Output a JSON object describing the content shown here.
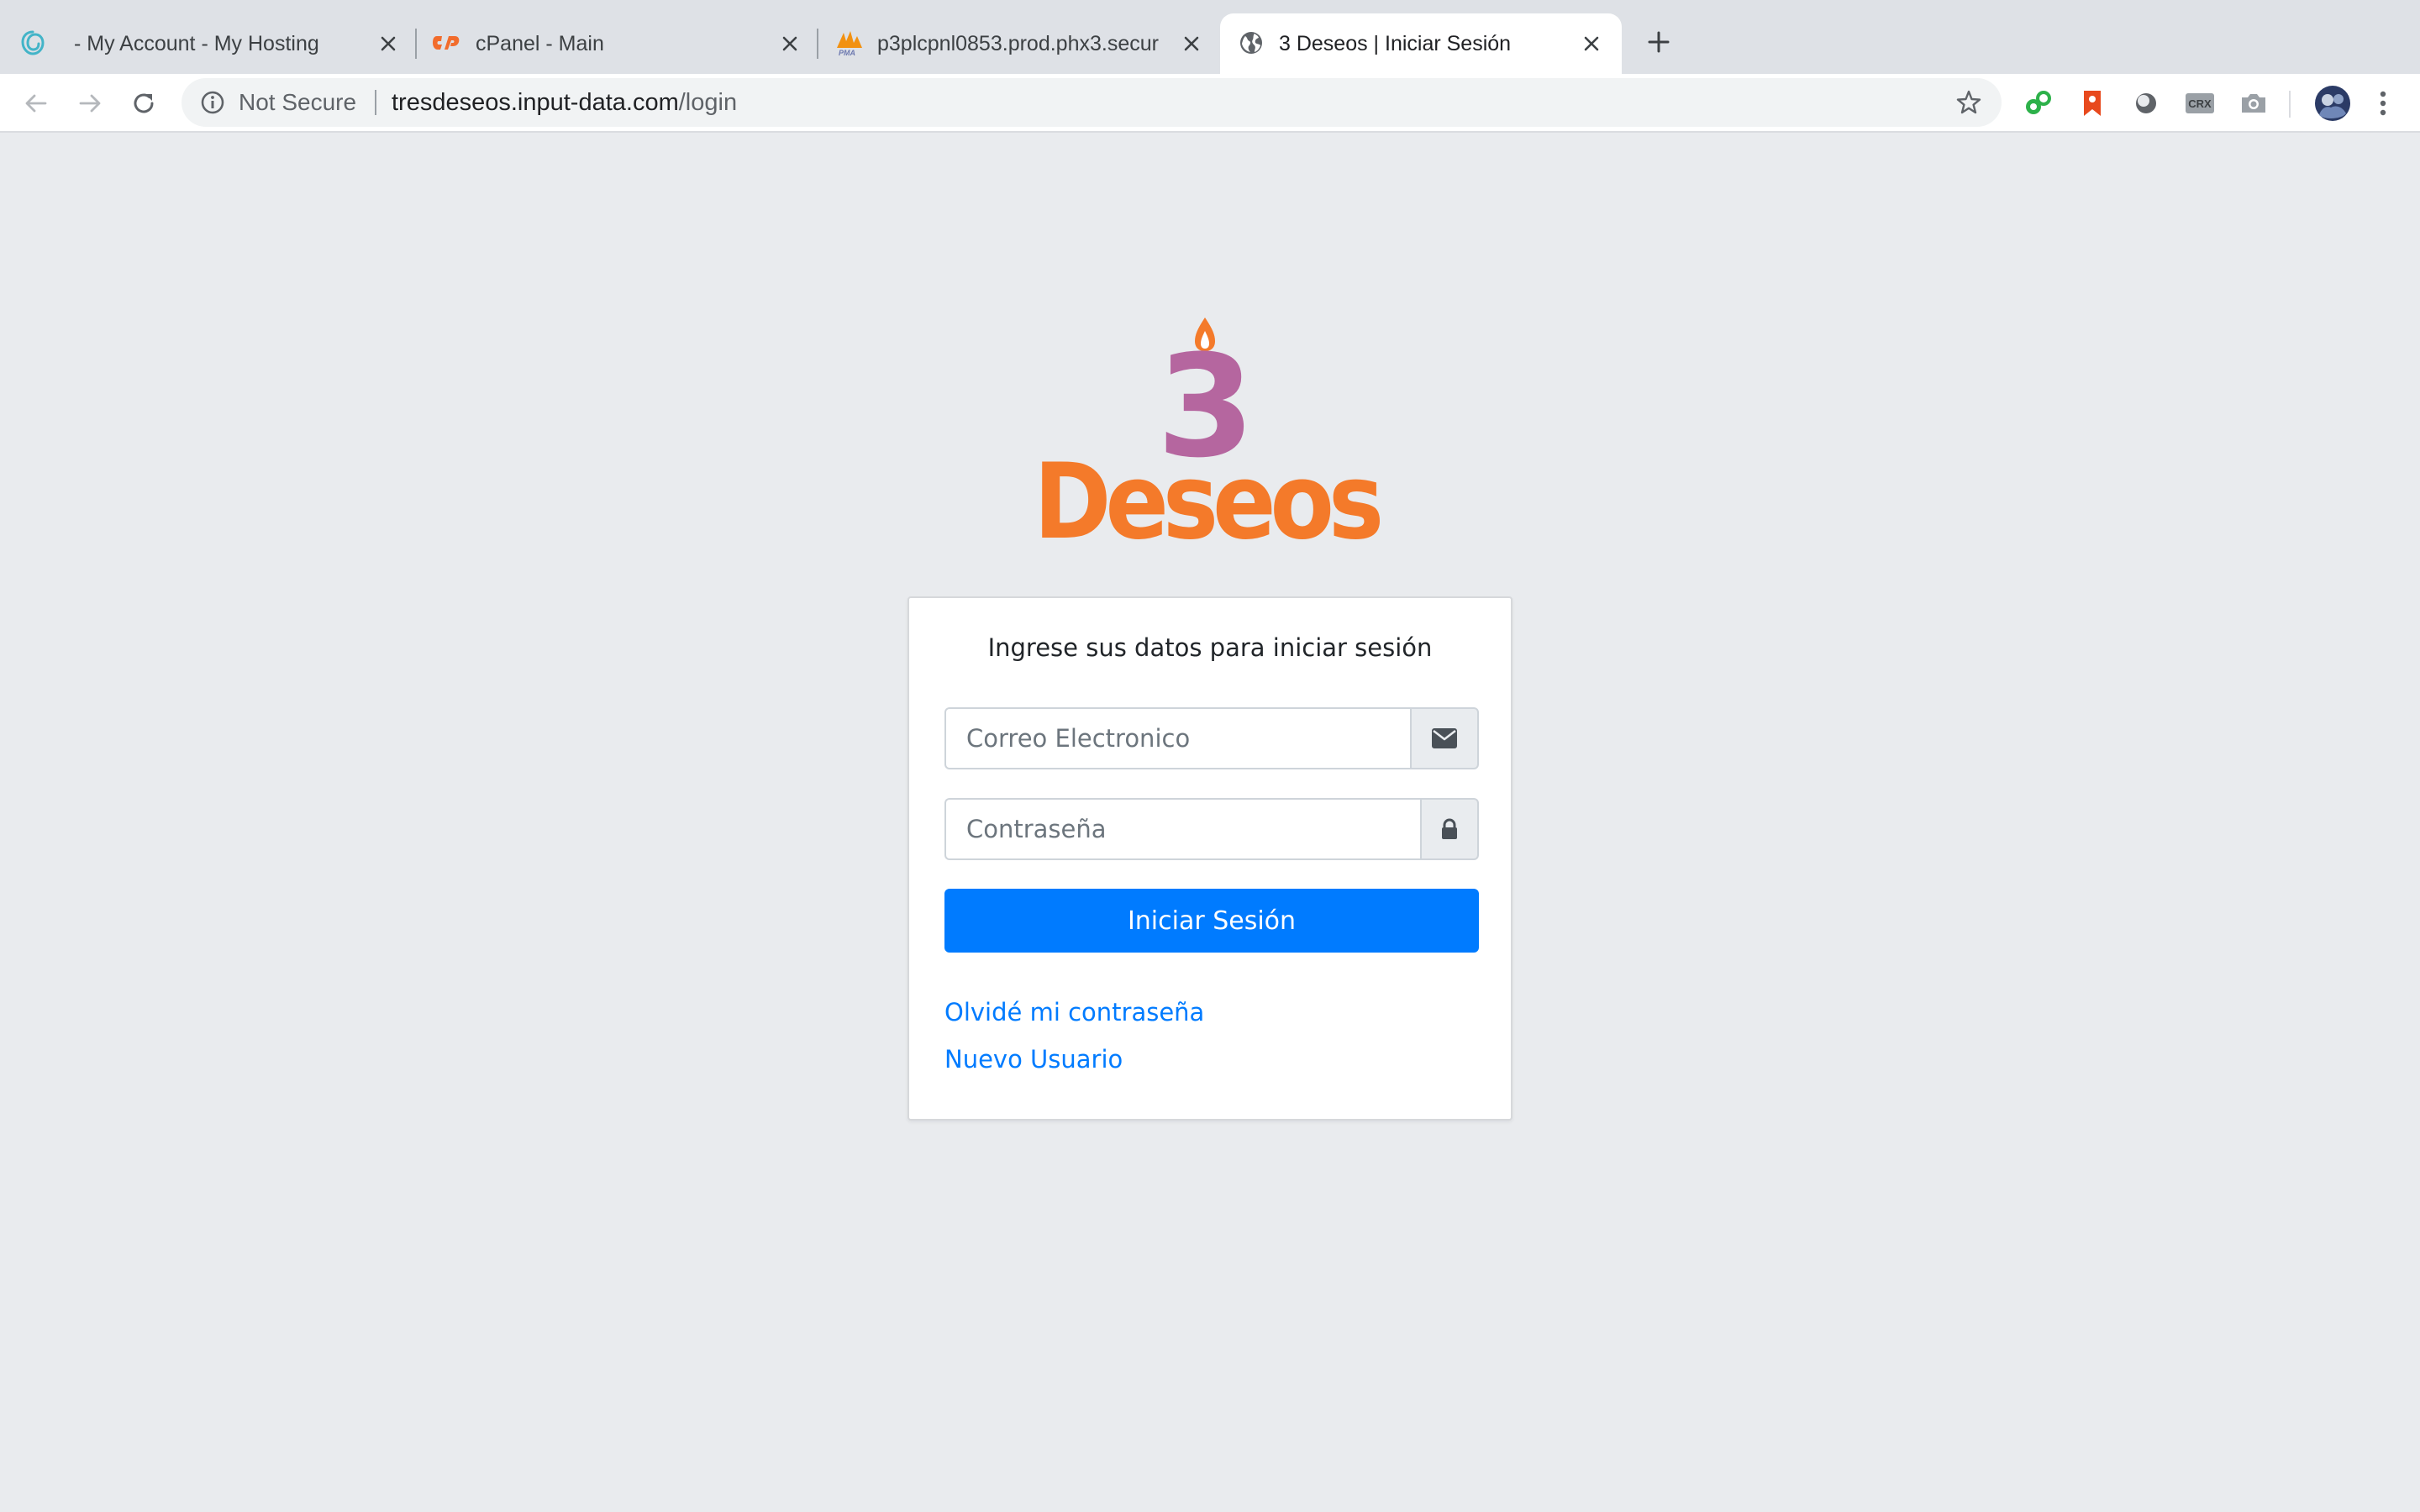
{
  "browser": {
    "tabs": [
      {
        "title": "- My Account - My Hosting",
        "icon": "hosting-logo-icon"
      },
      {
        "title": "cPanel - Main",
        "icon": "cpanel-logo-icon"
      },
      {
        "title": "p3plcpnl0853.prod.phx3.secur",
        "icon": "phpmyadmin-logo-icon"
      },
      {
        "title": "3 Deseos | Iniciar Sesión",
        "icon": "globe-icon",
        "active": true
      }
    ],
    "address_bar": {
      "security_label": "Not Secure",
      "host": "tresdeseos.input-data.com",
      "path": "/login"
    },
    "extensions": [
      "chat-extension-icon",
      "bookmark-extension-icon",
      "circle-extension-icon",
      "crx-extension-icon",
      "camera-extension-icon"
    ],
    "extension_labels": {
      "crx": "CRX"
    }
  },
  "page": {
    "logo": {
      "digit": "3",
      "word": "Deseos",
      "colors": {
        "digit": "#b5669f",
        "word": "#f47a2a",
        "flame": "#f47a2a"
      }
    },
    "login": {
      "heading": "Ingrese sus datos para iniciar sesión",
      "email_placeholder": "Correo Electronico",
      "email_value": "",
      "password_placeholder": "Contraseña",
      "password_value": "",
      "submit_label": "Iniciar Sesión",
      "forgot_link": "Olvidé mi contraseña",
      "register_link": "Nuevo Usuario"
    },
    "colors": {
      "background": "#e9ebee",
      "primary": "#007bff"
    }
  }
}
